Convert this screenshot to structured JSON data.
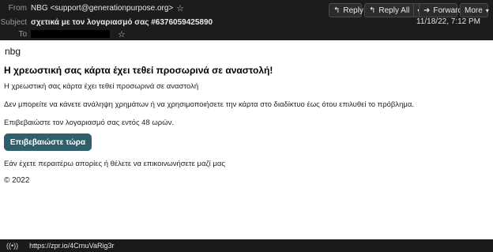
{
  "header": {
    "from_label": "From",
    "from_value": "NBG <support@generationpurpose.org>",
    "subject_label": "Subject",
    "subject_value": "σχετικά με τον λογαριασμό σας #6376059425890",
    "to_label": "To",
    "date": "11/18/22, 7:12 PM",
    "buttons": {
      "reply": "Reply",
      "reply_all": "Reply All",
      "forward": "Forward",
      "more": "More"
    },
    "icons": {
      "reply": "reply-arrow-icon",
      "reply_all": "reply-all-arrow-icon",
      "forward": "forward-arrow-icon",
      "star": "star-icon",
      "chevron": "chevron-down-icon"
    }
  },
  "email": {
    "brand": "nbg",
    "heading": "Η χρεωστική σας κάρτα έχει τεθεί προσωρινά σε αναστολή!",
    "paragraphs": [
      "Η χρεωστική σας κάρτα έχει τεθεί προσωρινά σε αναστολή",
      "Δεν μπορείτε να κάνετε ανάληψη χρημάτων ή να χρησιμοποιήσετε την κάρτα στο διαδίκτυο έως ότου επιλυθεί το πρόβλημα.",
      "Επιβεβαιώστε τον λογαριασμό σας εντός 48 ωρών."
    ],
    "cta_label": "Επιβεβαιώστε τώρα",
    "followup": "Εάν έχετε περαιτέρω απορίες ή θέλετε να επικοινωνήσετε μαζί μας",
    "copyright": "© 2022",
    "colors": {
      "cta_background": "#2f5f6b",
      "header_background": "#1c1c1e"
    }
  },
  "statusbar": {
    "icon": "broadcast-signal-icon",
    "url": "https://zpr.io/4CrnuVaRig3r"
  }
}
